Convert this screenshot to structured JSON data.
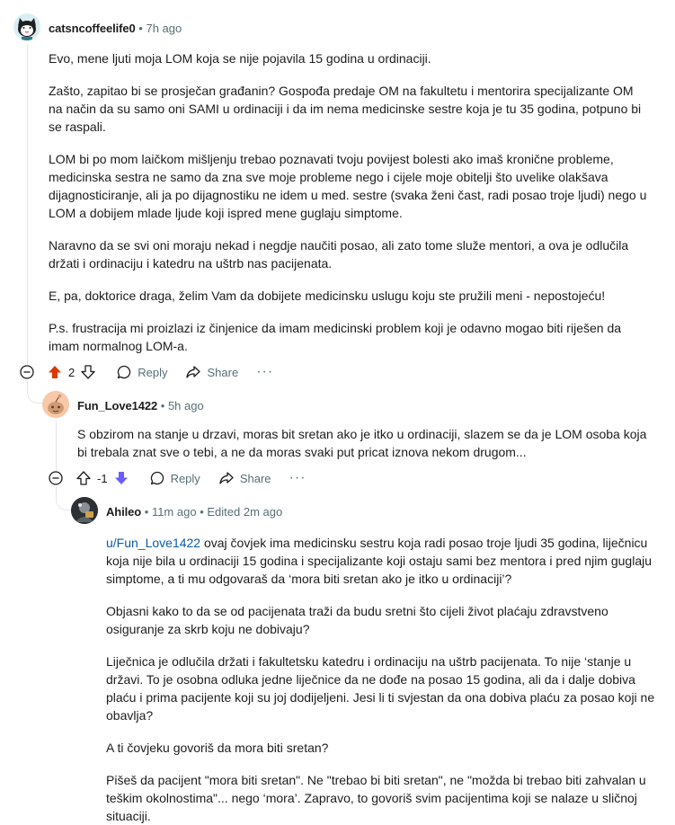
{
  "comments": [
    {
      "username": "catsncoffeelife0",
      "separator": "•",
      "time": "7h ago",
      "paragraphs": [
        "Evo, mene ljuti moja LOM koja se nije pojavila 15 godina u ordinaciji.",
        "Zašto, zapitao bi se prosječan građanin? Gospođa predaje OM na fakultetu i mentorira specijalizante OM na način da su samo oni SAMI u ordinaciji i da im nema medicinske sestre koja je tu 35 godina, potpuno bi se raspali.",
        "LOM bi po mom laičkom mišljenju trebao poznavati tvoju povijest bolesti ako imaš kronične probleme, medicinska sestra ne samo da zna sve moje probleme nego i cijele moje obitelji što uvelike olakšava dijagnosticiranje, ali ja po dijagnostiku ne idem u med. sestre (svaka ženi čast, radi posao troje ljudi) nego u LOM a dobijem mlade ljude koji ispred mene guglaju simptome.",
        "Naravno da se svi oni moraju nekad i negdje naučiti posao, ali zato tome služe mentori, a ova je odlučila držati i ordinaciju i katedru na uštrb nas pacijenata.",
        "E, pa, doktorice draga, želim Vam da dobijete medicinsku uslugu koju ste pružili meni - nepostojeću!",
        "P.s. frustracija mi proizlazi iz činjenice da imam medicinski problem koji je odavno mogao biti riješen da imam normalnog LOM-a."
      ],
      "score": "2",
      "vote_state": "upvoted",
      "reply_label": "Reply",
      "share_label": "Share",
      "more_label": "···"
    },
    {
      "username": "Fun_Love1422",
      "separator": "•",
      "time": "5h ago",
      "paragraphs": [
        "S obzirom na stanje u drzavi, moras bit sretan ako je itko u ordinaciji, slazem se da je LOM osoba koja bi trebala znat sve o tebi, a ne da moras svaki put pricat iznova nekom drugom..."
      ],
      "score": "-1",
      "vote_state": "downvoted",
      "reply_label": "Reply",
      "share_label": "Share",
      "more_label": "···"
    },
    {
      "username": "Ahileo",
      "separator": "•",
      "time": "11m ago",
      "separator2": "•",
      "edited": "Edited 2m ago",
      "mention": "u/Fun_Love1422",
      "first_paragraph_rest": " ovaj čovjek ima medicinsku sestru koja radi posao troje ljudi 35 godina, liječnicu koja nije bila u ordinaciji 15 godina i specijalizante koji ostaju sami bez mentora i pred njim guglaju simptome, a ti mu odgovaraš da ‘mora biti sretan ako je itko u ordinaciji’?",
      "paragraphs": [
        "Objasni kako to da se od pacijenata traži da budu sretni što cijeli život plaćaju zdravstveno osiguranje za skrb koju ne dobivaju?",
        "Liječnica je odlučila držati i fakultetsku katedru i ordinaciju na uštrb pacijenata. To nije ‘stanje u državi. To je osobna odluka jedne liječnice da ne dođe na posao 15 godina, ali da i dalje dobiva plaću i prima pacijente koji su joj dodijeljeni. Jesi li ti svjestan da ona dobiva plaću za posao koji ne obavlja?",
        "A ti čovjeku govoriš da mora biti sretan?",
        "Pišeš da pacijent \"mora biti sretan\". Ne \"trebao bi biti sretan\", ne \"možda bi trebao biti zahvalan u teškim okolnostima\"... nego ‘mora’. Zapravo, to govoriš svim pacijentima koji se nalaze u sličnoj situaciji."
      ]
    }
  ],
  "colors": {
    "upvote_active": "#d93a00",
    "downvote_active": "#6a5cff",
    "meta": "#576f76",
    "link": "#0a5ca8",
    "thread_line": "#e4e6e8"
  },
  "icons": [
    "cat-avatar-icon",
    "snoo-avatar-icon",
    "user-photo-avatar",
    "upvote-arrow-icon",
    "downvote-arrow-icon",
    "comment-bubble-icon",
    "share-arrow-icon",
    "collapse-minus-icon",
    "more-options-icon"
  ]
}
